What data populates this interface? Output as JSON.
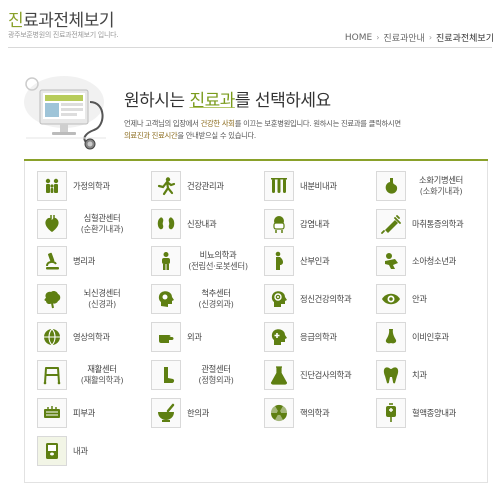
{
  "header": {
    "title_accent": "진",
    "title_rest": "료과전체보기",
    "subtitle": "광주보훈병원의 진료과전체보기 입니다."
  },
  "breadcrumb": {
    "home": "HOME",
    "level1": "진료과안내",
    "current": "진료과전체보기"
  },
  "hero": {
    "title_pre": "원하시는 ",
    "title_highlight": "진료과",
    "title_post": "를 선택하세요",
    "desc_line1_pre": "언제나 고객님의 입장에서 ",
    "desc_line1_hl1": "건강한 사회",
    "desc_line1_mid": "를 이끄는 보훈병원입니다. 원하시는 진료과를 클릭하시면",
    "desc_line2_hl": "의료진과 진료시간",
    "desc_line2_post": "을 안내받으실 수 있습니다."
  },
  "departments": [
    {
      "label": "가정의학과",
      "icon": "family-icon"
    },
    {
      "label": "건강관리과",
      "icon": "running-person-icon"
    },
    {
      "label": "내분비내과",
      "icon": "test-tubes-icon"
    },
    {
      "label": "소화기병센터",
      "label2": "(소화기내과)",
      "icon": "stomach-icon"
    },
    {
      "label": "심혈관센터",
      "label2": "(순환기내과)",
      "icon": "heart-icon"
    },
    {
      "label": "신장내과",
      "icon": "kidney-icon"
    },
    {
      "label": "감염내과",
      "icon": "mask-icon"
    },
    {
      "label": "마취통증의학과",
      "icon": "syringe-icon"
    },
    {
      "label": "병리과",
      "icon": "microscope-icon"
    },
    {
      "label": "비뇨의학과",
      "label2": "(전립선·로봇센터)",
      "icon": "body-icon"
    },
    {
      "label": "산부인과",
      "icon": "pregnant-icon"
    },
    {
      "label": "소아청소년과",
      "icon": "baby-icon"
    },
    {
      "label": "뇌신경센터",
      "label2": "(신경과)",
      "icon": "brain-icon"
    },
    {
      "label": "척추센터",
      "label2": "(신경외과)",
      "icon": "head-brain-icon"
    },
    {
      "label": "정신건강의학과",
      "icon": "mind-icon"
    },
    {
      "label": "안과",
      "icon": "eye-icon"
    },
    {
      "label": "영상의학과",
      "icon": "globe-icon"
    },
    {
      "label": "외과",
      "icon": "hand-icon"
    },
    {
      "label": "응급의학과",
      "icon": "emergency-face-icon"
    },
    {
      "label": "이비인후과",
      "icon": "nose-icon"
    },
    {
      "label": "재활센터",
      "label2": "(재활의학과)",
      "icon": "walker-icon"
    },
    {
      "label": "관절센터",
      "label2": "(정형외과)",
      "icon": "leg-icon"
    },
    {
      "label": "진단검사의학과",
      "icon": "flask-icon"
    },
    {
      "label": "치과",
      "icon": "tooth-icon"
    },
    {
      "label": "피부과",
      "icon": "skin-icon"
    },
    {
      "label": "한의과",
      "icon": "mortar-icon"
    },
    {
      "label": "핵의학과",
      "icon": "radiation-icon"
    },
    {
      "label": "혈액종양내과",
      "icon": "blood-bag-icon"
    },
    {
      "label": "내과",
      "icon": "internal-icon"
    }
  ],
  "colors": {
    "accent_green": "#8aa12a",
    "icon_green": "#5e7f12",
    "text_dark": "#444444"
  }
}
